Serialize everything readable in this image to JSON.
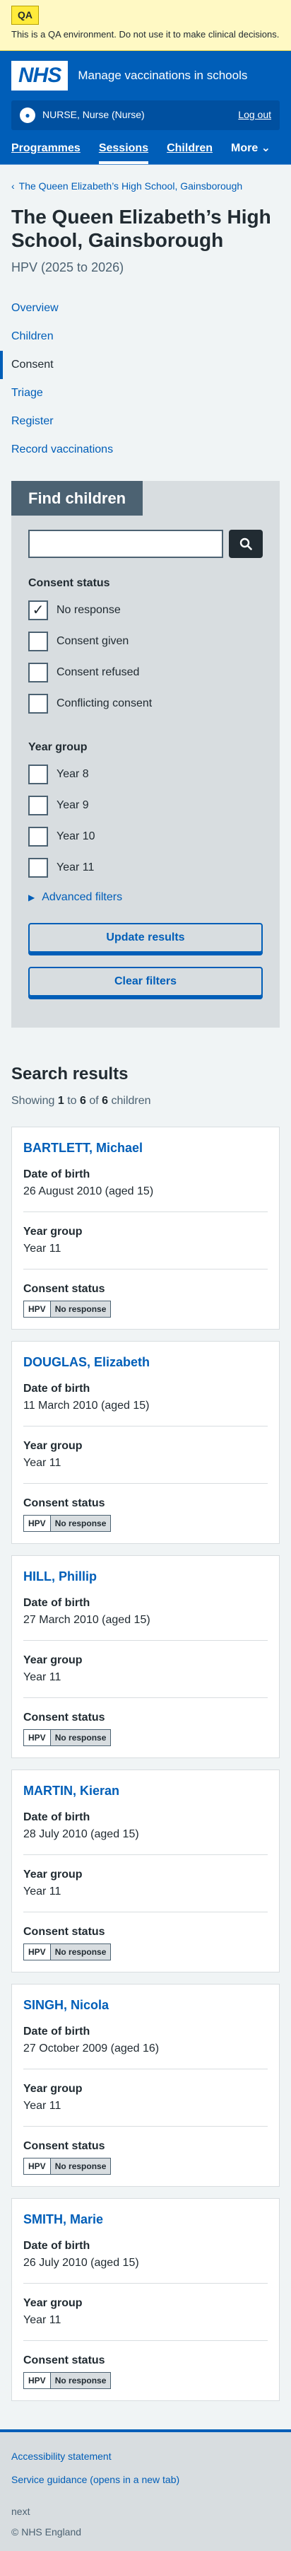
{
  "qa": {
    "tag": "QA",
    "text": "This is a QA environment. Do not use it to make clinical decisions."
  },
  "header": {
    "logo": "NHS",
    "service": "Manage vaccinations in schools",
    "user": "NURSE, Nurse (Nurse)",
    "logout": "Log out",
    "nav": [
      "Programmes",
      "Sessions",
      "Children",
      "More"
    ]
  },
  "breadcrumb": "The Queen Elizabeth’s High School, Gainsborough",
  "page": {
    "title": "The Queen Elizabeth’s High School, Gainsborough",
    "subtitle": "HPV (2025 to 2026)"
  },
  "subnav": [
    "Overview",
    "Children",
    "Consent",
    "Triage",
    "Register",
    "Record vaccinations"
  ],
  "filters": {
    "title": "Find children",
    "search_placeholder": "",
    "consent_legend": "Consent status",
    "consent_options": [
      "No response",
      "Consent given",
      "Consent refused",
      "Conflicting consent"
    ],
    "year_legend": "Year group",
    "year_options": [
      "Year 8",
      "Year 9",
      "Year 10",
      "Year 11"
    ],
    "advanced": "Advanced filters",
    "update": "Update results",
    "clear": "Clear filters"
  },
  "results": {
    "heading": "Search results",
    "count_prefix": "Showing",
    "count_from": "1",
    "count_to_word": "to",
    "count_to": "6",
    "count_of_word": "of",
    "count_total": "6",
    "count_suffix": "children",
    "labels": {
      "dob": "Date of birth",
      "year": "Year group",
      "consent": "Consent status"
    },
    "tag_programme": "HPV",
    "children": [
      {
        "name": "BARTLETT, Michael",
        "dob": "26 August 2010 (aged 15)",
        "year": "Year 11",
        "status": "No response"
      },
      {
        "name": "DOUGLAS, Elizabeth",
        "dob": "11 March 2010 (aged 15)",
        "year": "Year 11",
        "status": "No response"
      },
      {
        "name": "HILL, Phillip",
        "dob": "27 March 2010 (aged 15)",
        "year": "Year 11",
        "status": "No response"
      },
      {
        "name": "MARTIN, Kieran",
        "dob": "28 July 2010 (aged 15)",
        "year": "Year 11",
        "status": "No response"
      },
      {
        "name": "SINGH, Nicola",
        "dob": "27 October 2009 (aged 16)",
        "year": "Year 11",
        "status": "No response"
      },
      {
        "name": "SMITH, Marie",
        "dob": "26 July 2010 (aged 15)",
        "year": "Year 11",
        "status": "No response"
      }
    ]
  },
  "footer": {
    "links": [
      "Accessibility statement",
      "Service guidance (opens in a new tab)"
    ],
    "next": "next",
    "copyright": "© NHS England"
  }
}
